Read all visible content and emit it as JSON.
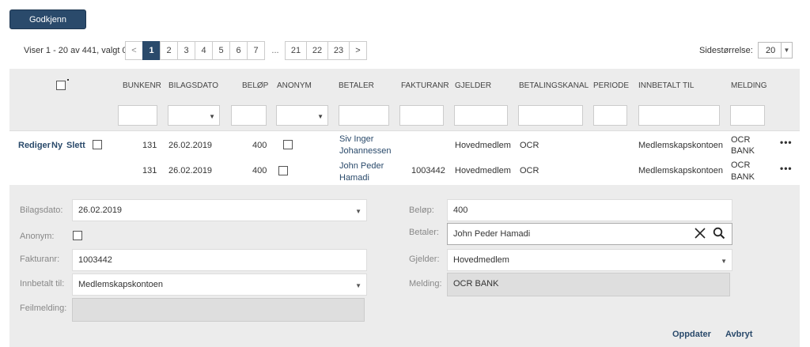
{
  "toolbar": {
    "approve_label": "Godkjenn"
  },
  "pagination": {
    "showing": "Viser 1 - 20 av 441, valgt 0",
    "prev": "<",
    "pages": [
      "1",
      "2",
      "3",
      "4",
      "5",
      "6",
      "7"
    ],
    "ellipsis": "...",
    "last_pages": [
      "21",
      "22",
      "23"
    ],
    "next": ">",
    "current_page": "1",
    "page_size_label": "Sidestørrelse:",
    "page_size_value": "20"
  },
  "grid": {
    "columns": [
      "BUNKENR",
      "BILAGSDATO",
      "BELØP",
      "ANONYM",
      "BETALER",
      "FAKTURANR",
      "GJELDER",
      "BETALINGSKANAL",
      "PERIODE",
      "INNBETALT TIL",
      "MELDING"
    ],
    "row_actions": {
      "edit": "Rediger",
      "new": "Ny",
      "delete": "Slett"
    },
    "rows": [
      {
        "bunkenr": "131",
        "bilagsdato": "26.02.2019",
        "belop": "400",
        "betaler_line1": "Siv Inger",
        "betaler_line2": "Johannessen",
        "fakturanr": "",
        "gjelder": "Hovedmedlem",
        "kanal": "OCR",
        "periode": "",
        "innbetalt_til": "Medlemskapskontoen",
        "melding_line1": "OCR",
        "melding_line2": "BANK"
      },
      {
        "bunkenr": "131",
        "bilagsdato": "26.02.2019",
        "belop": "400",
        "betaler_line1": "John Peder",
        "betaler_line2": "Hamadi",
        "fakturanr": "1003442",
        "gjelder": "Hovedmedlem",
        "kanal": "OCR",
        "periode": "",
        "innbetalt_til": "Medlemskapskontoen",
        "melding_line1": "OCR",
        "melding_line2": "BANK"
      }
    ]
  },
  "form": {
    "bilagsdato_label": "Bilagsdato:",
    "bilagsdato_value": "26.02.2019",
    "anonym_label": "Anonym:",
    "fakturanr_label": "Fakturanr:",
    "fakturanr_value": "1003442",
    "innbetalt_label": "Innbetalt til:",
    "innbetalt_value": "Medlemskapskontoen",
    "feilmelding_label": "Feilmelding:",
    "feilmelding_value": "",
    "belop_label": "Beløp:",
    "belop_value": "400",
    "betaler_label": "Betaler:",
    "betaler_value": "John Peder Hamadi",
    "gjelder_label": "Gjelder:",
    "gjelder_value": "Hovedmedlem",
    "melding_label": "Melding:",
    "melding_value": "OCR BANK",
    "update_label": "Oppdater",
    "cancel_label": "Avbryt"
  },
  "colors": {
    "primary": "#2a4a6b",
    "panel": "#ececec"
  },
  "icons": [
    "close-icon",
    "search-icon",
    "more-icon",
    "chevron-down-icon"
  ]
}
